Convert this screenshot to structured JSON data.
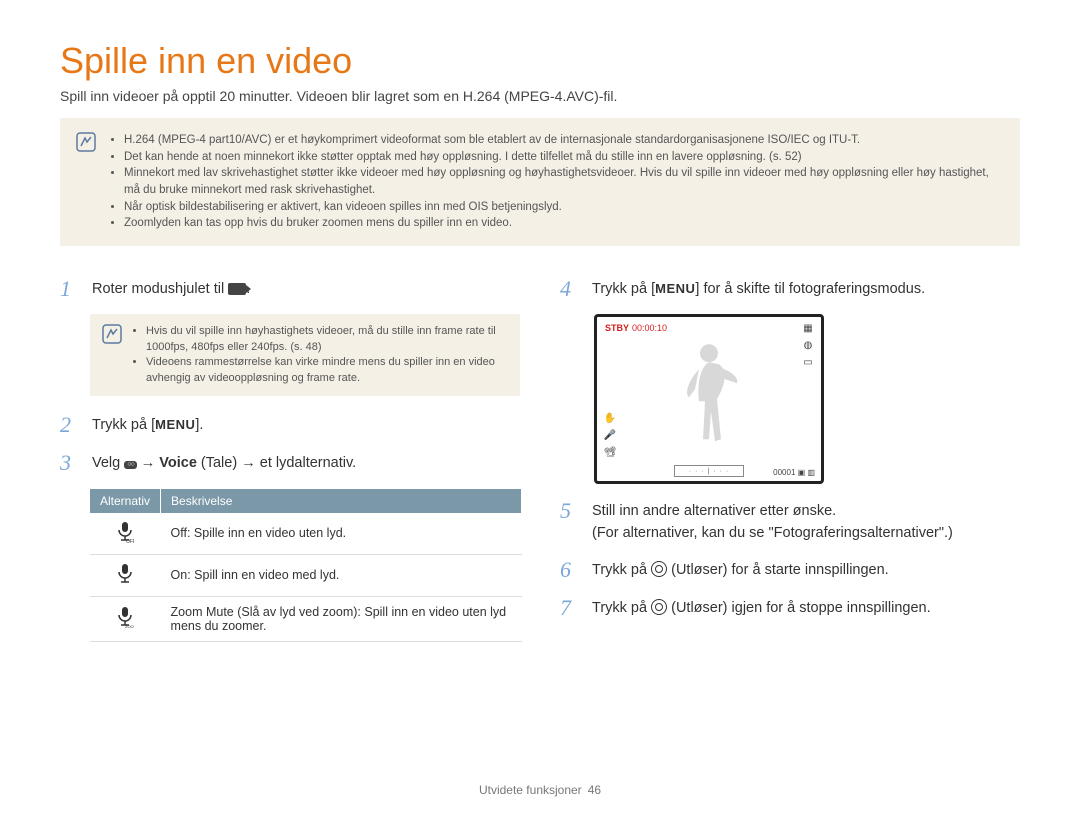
{
  "title": "Spille inn en video",
  "subtitle": "Spill inn videoer på opptil 20 minutter. Videoen blir lagret som en H.264 (MPEG-4.AVC)-fil.",
  "top_notes": [
    "H.264 (MPEG-4 part10/AVC) er et høykomprimert videoformat som ble etablert av de internasjonale standardorganisasjonene ISO/IEC og ITU-T.",
    "Det kan hende at noen minnekort ikke støtter opptak med høy oppløsning. I dette tilfellet må du stille inn en lavere oppløsning. (s. 52)",
    "Minnekort med lav skrivehastighet støtter ikke videoer med høy oppløsning og høyhastighetsvideoer. Hvis du vil spille inn videoer med høy oppløsning eller høy hastighet, må du bruke minnekort med rask skrivehastighet.",
    "Når optisk bildestabilisering er aktivert, kan videoen spilles inn med OIS betjeningslyd.",
    "Zoomlyden kan tas opp hvis du bruker zoomen mens du spiller inn en video."
  ],
  "steps_left": {
    "s1": {
      "num": "1",
      "text_a": "Roter modushjulet til ",
      "text_b": "."
    },
    "s1_notes": [
      "Hvis du vil spille inn høyhastighets videoer, må du stille inn frame rate til 1000fps, 480fps eller 240fps. (s. 48)",
      "Videoens rammestørrelse kan virke mindre mens du spiller inn en video avhengig av videooppløsning og frame rate."
    ],
    "s2": {
      "num": "2",
      "text_a": "Trykk på [",
      "menu": "MENU",
      "text_b": "]."
    },
    "s3": {
      "num": "3",
      "text_a": "Velg ",
      "arrow1": " → ",
      "voice_bold": "Voice",
      "voice_paren": " (Tale)",
      "arrow2": " → ",
      "text_b": "et lydalternativ."
    }
  },
  "table": {
    "h1": "Alternativ",
    "h2": "Beskrivelse",
    "rows": [
      {
        "icon": "mic-off",
        "bold": "Off",
        "text": ": Spille inn en video uten lyd."
      },
      {
        "icon": "mic-on",
        "bold": "On",
        "text": ": Spill inn en video med lyd."
      },
      {
        "icon": "mic-zoom",
        "bold": "Zoom Mute",
        "text": " (Slå av lyd ved zoom): Spill inn en video uten lyd mens du zoomer."
      }
    ]
  },
  "steps_right": {
    "s4": {
      "num": "4",
      "text_a": "Trykk på [",
      "menu": "MENU",
      "text_b": "] for å skifte til fotograferingsmodus."
    },
    "s5": {
      "num": "5",
      "text_a": "Still inn andre alternativer etter ønske.",
      "text_b": "(For alternativer, kan du se \"Fotograferingsalternativer\".)"
    },
    "s6": {
      "num": "6",
      "text_a": "Trykk på ",
      "text_b": " (Utløser) for å starte innspillingen."
    },
    "s7": {
      "num": "7",
      "text_a": "Trykk på ",
      "text_b": " (Utløser) igjen for å stoppe innspillingen."
    }
  },
  "cam": {
    "stby": "STBY",
    "time": "00:00:10",
    "counter": "00001",
    "bar": "· · · | · · ·"
  },
  "footer": {
    "section": "Utvidete funksjoner",
    "page": "46"
  }
}
